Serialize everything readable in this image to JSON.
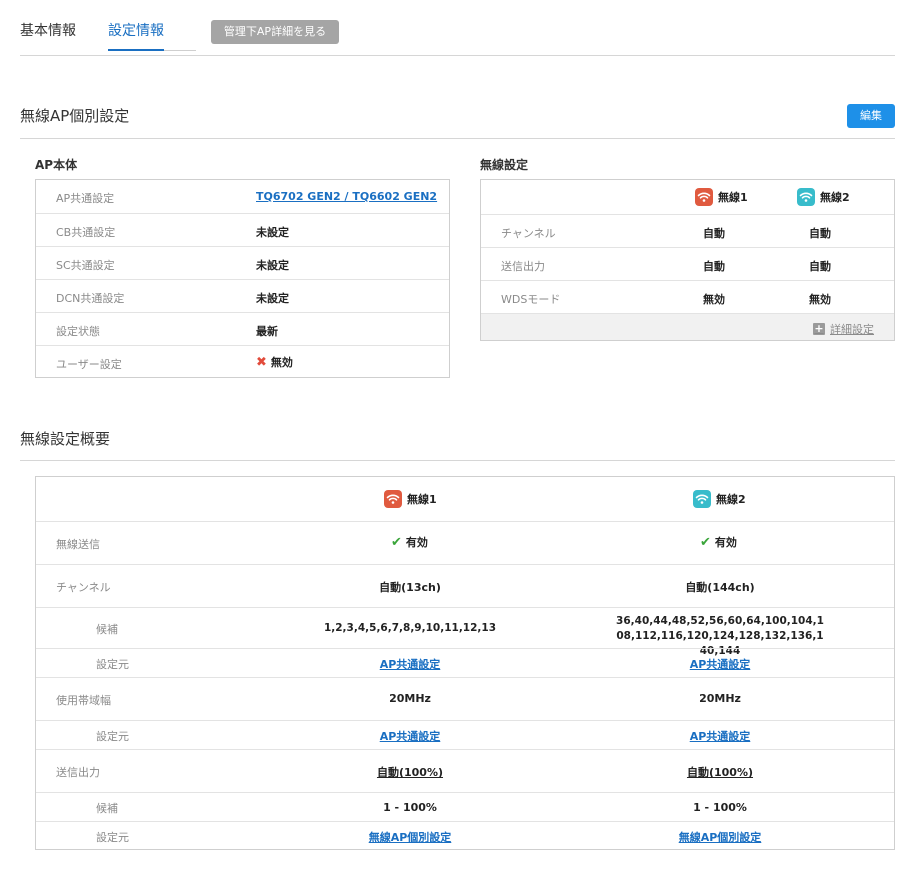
{
  "tabs": [
    {
      "label": "基本情報"
    },
    {
      "label": "設定情報"
    }
  ],
  "manage_button": "管理下AP詳細を見る",
  "section1": {
    "title": "無線AP個別設定",
    "edit_button": "編集"
  },
  "ap_body": {
    "title": "AP本体",
    "rows": [
      {
        "label": "AP共通設定",
        "value": "TQ6702 GEN2 / TQ6602 GEN2"
      },
      {
        "label": "CB共通設定",
        "value": "未設定"
      },
      {
        "label": "SC共通設定",
        "value": "未設定"
      },
      {
        "label": "DCN共通設定",
        "value": "未設定"
      },
      {
        "label": "設定状態",
        "value": "最新"
      },
      {
        "label": "ユーザー設定",
        "value": "無効"
      }
    ]
  },
  "wireless": {
    "title": "無線設定",
    "radio1": "無線1",
    "radio2": "無線2",
    "rows": [
      {
        "label": "チャンネル",
        "v1": "自動",
        "v2": "自動"
      },
      {
        "label": "送信出力",
        "v1": "自動",
        "v2": "自動"
      },
      {
        "label": "WDSモード",
        "v1": "無効",
        "v2": "無効"
      }
    ],
    "detail_link": "詳細設定"
  },
  "section2": {
    "title": "無線設定概要"
  },
  "overview": {
    "radio1": "無線1",
    "radio2": "無線2",
    "rows": {
      "tx": {
        "label": "無線送信",
        "v1": "有効",
        "v2": "有効"
      },
      "channel": {
        "label": "チャンネル",
        "v1": "自動(13ch)",
        "v2": "自動(144ch)"
      },
      "ch_candidate": {
        "label": "候補",
        "v1": "1,2,3,4,5,6,7,8,9,10,11,12,13",
        "v2": "36,40,44,48,52,56,60,64,100,104,108,112,116,120,124,128,132,136,140,144"
      },
      "ch_source": {
        "label": "設定元",
        "v1": "AP共通設定",
        "v2": "AP共通設定"
      },
      "bandwidth": {
        "label": "使用帯域幅",
        "v1": "20MHz",
        "v2": "20MHz"
      },
      "bw_source": {
        "label": "設定元",
        "v1": "AP共通設定",
        "v2": "AP共通設定"
      },
      "power": {
        "label": "送信出力",
        "v1a": "自動",
        "v1b": "(100%)",
        "v2a": "自動",
        "v2b": "(100%)"
      },
      "pw_candidate": {
        "label": "候補",
        "v1": "1 - 100%",
        "v2": "1 - 100%"
      },
      "pw_source": {
        "label": "設定元",
        "v1": "無線AP個別設定",
        "v2": "無線AP個別設定"
      }
    }
  },
  "colors": {
    "accent": "#1a6fc2",
    "radio1": "#e05a3f",
    "radio2": "#38bccb",
    "enabled": "#3aa53a",
    "disabled": "#e24b3b"
  }
}
